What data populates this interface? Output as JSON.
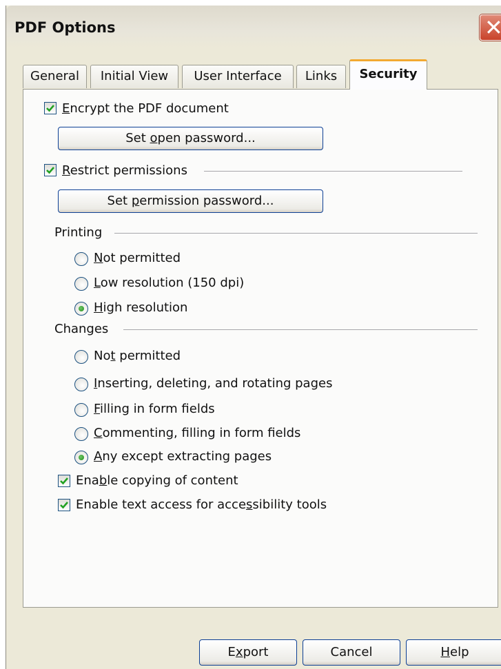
{
  "window": {
    "title": "PDF Options",
    "close_glyph": "✕"
  },
  "tabs": [
    {
      "label": "General"
    },
    {
      "label": "Initial View"
    },
    {
      "label": "User Interface"
    },
    {
      "label": "Links"
    },
    {
      "label": "Security",
      "active": true
    }
  ],
  "security": {
    "encrypt": {
      "pre": "",
      "u": "E",
      "post": "ncrypt the PDF document",
      "checked": true
    },
    "open_password_button": {
      "pre": "Set ",
      "u": "o",
      "post": "pen password..."
    },
    "restrict": {
      "pre": "",
      "u": "R",
      "post": "estrict permissions",
      "checked": true
    },
    "permission_password_button": {
      "pre": "Set ",
      "u": "p",
      "post": "ermission password..."
    },
    "printing": {
      "label": "Printing",
      "options": [
        {
          "pre": "",
          "u": "N",
          "post": "ot permitted",
          "selected": false
        },
        {
          "pre": "",
          "u": "L",
          "post": "ow resolution (150 dpi)",
          "selected": false
        },
        {
          "pre": "",
          "u": "H",
          "post": "igh resolution",
          "selected": true
        }
      ]
    },
    "changes": {
      "label": "Changes",
      "options": [
        {
          "pre": "No",
          "u": "t",
          "post": " permitted",
          "selected": false
        },
        {
          "pre": "",
          "u": "I",
          "post": "nserting, deleting, and rotating pages",
          "selected": false
        },
        {
          "pre": "",
          "u": "F",
          "post": "illing in form fields",
          "selected": false
        },
        {
          "pre": "",
          "u": "C",
          "post": "ommenting, filling in form fields",
          "selected": false
        },
        {
          "pre": "",
          "u": "A",
          "post": "ny except extracting pages",
          "selected": true
        }
      ]
    },
    "copy": {
      "pre": "Ena",
      "u": "b",
      "post": "le copying of content",
      "checked": true
    },
    "accessibility": {
      "pre": "Enable text access for acce",
      "u": "s",
      "post": "sibility tools",
      "checked": true
    }
  },
  "footer": {
    "export": {
      "pre": "E",
      "u": "x",
      "post": "port"
    },
    "cancel": {
      "pre": "Cancel",
      "u": "",
      "post": ""
    },
    "help": {
      "pre": "",
      "u": "H",
      "post": "elp"
    }
  },
  "colors": {
    "dialog_bg": "#ece9d8",
    "panel_bg": "#fbfbfa",
    "active_tab_accent": "#f2a931",
    "check_green": "#21a121"
  }
}
